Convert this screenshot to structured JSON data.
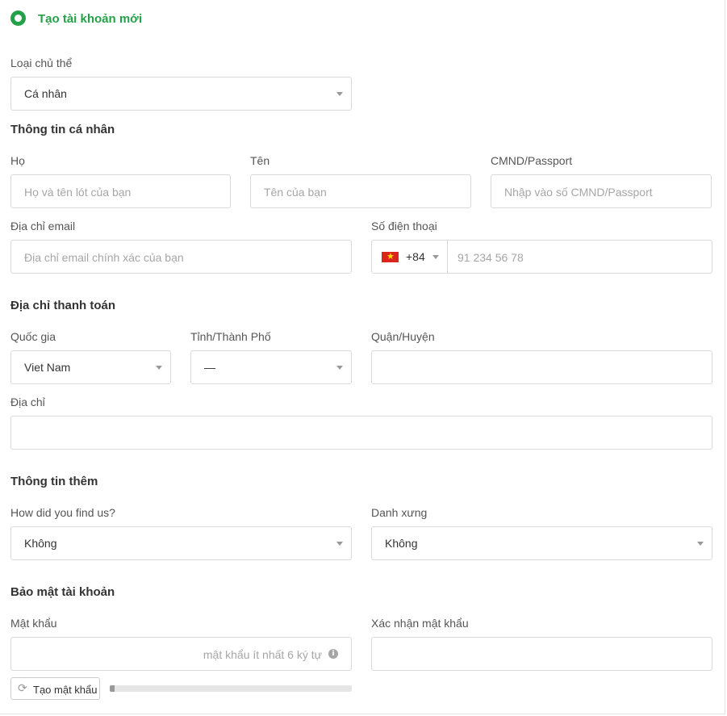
{
  "header": {
    "option_label": "Tạo tài khoản mới"
  },
  "entity": {
    "label": "Loại chủ thể",
    "value": "Cá nhân"
  },
  "personal": {
    "title": "Thông tin cá nhân",
    "last_name": {
      "label": "Họ",
      "placeholder": "Họ và tên lót của bạn"
    },
    "first_name": {
      "label": "Tên",
      "placeholder": "Tên của bạn"
    },
    "id_number": {
      "label": "CMND/Passport",
      "placeholder": "Nhập vào số CMND/Passport"
    },
    "email": {
      "label": "Địa chỉ email",
      "placeholder": "Địa chỉ email chính xác của bạn"
    },
    "phone": {
      "label": "Số điện thoại",
      "country_code": "+84",
      "placeholder": "91 234 56 78"
    }
  },
  "billing": {
    "title": "Địa chỉ thanh toán",
    "country": {
      "label": "Quốc gia",
      "value": "Viet Nam"
    },
    "province": {
      "label": "Tỉnh/Thành Phố",
      "value": "—"
    },
    "district": {
      "label": "Quận/Huyện",
      "value": ""
    },
    "address": {
      "label": "Địa chỉ",
      "value": ""
    }
  },
  "extra": {
    "title": "Thông tin thêm",
    "source": {
      "label": "How did you find us?",
      "value": "Không"
    },
    "salutation": {
      "label": "Danh xưng",
      "value": "Không"
    }
  },
  "security": {
    "title": "Bảo mật tài khoản",
    "password": {
      "label": "Mật khẩu",
      "placeholder": "mật khẩu ít nhất 6 ký tự"
    },
    "confirm": {
      "label": "Xác nhận mật khẩu",
      "value": ""
    },
    "generate_label": "Tạo mật khẩu",
    "strength_level": 0.02
  },
  "colors": {
    "accent": "#24a148",
    "flag_red": "#da251d",
    "flag_star": "#ffde00"
  },
  "icons": [
    "radio-selected-icon",
    "chevron-down-icon",
    "vietnam-flag-icon",
    "info-icon",
    "refresh-icon"
  ]
}
